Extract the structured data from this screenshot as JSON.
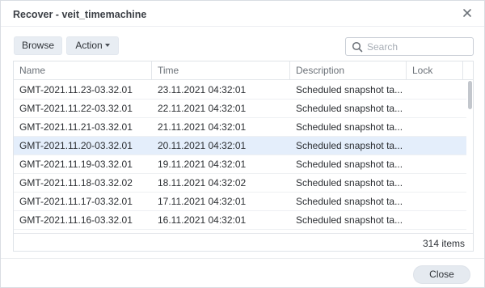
{
  "dialog": {
    "title": "Recover - veit_timemachine"
  },
  "toolbar": {
    "browse_label": "Browse",
    "action_label": "Action"
  },
  "search": {
    "placeholder": "Search",
    "value": ""
  },
  "table": {
    "columns": [
      "Name",
      "Time",
      "Description",
      "Lock"
    ],
    "rows": [
      {
        "name": "GMT-2021.11.23-03.32.01",
        "time": "23.11.2021 04:32:01",
        "description": "Scheduled snapshot ta...",
        "lock": "",
        "selected": false
      },
      {
        "name": "GMT-2021.11.22-03.32.01",
        "time": "22.11.2021 04:32:01",
        "description": "Scheduled snapshot ta...",
        "lock": "",
        "selected": false
      },
      {
        "name": "GMT-2021.11.21-03.32.01",
        "time": "21.11.2021 04:32:01",
        "description": "Scheduled snapshot ta...",
        "lock": "",
        "selected": false
      },
      {
        "name": "GMT-2021.11.20-03.32.01",
        "time": "20.11.2021 04:32:01",
        "description": "Scheduled snapshot ta...",
        "lock": "",
        "selected": true
      },
      {
        "name": "GMT-2021.11.19-03.32.01",
        "time": "19.11.2021 04:32:01",
        "description": "Scheduled snapshot ta...",
        "lock": "",
        "selected": false
      },
      {
        "name": "GMT-2021.11.18-03.32.02",
        "time": "18.11.2021 04:32:02",
        "description": "Scheduled snapshot ta...",
        "lock": "",
        "selected": false
      },
      {
        "name": "GMT-2021.11.17-03.32.01",
        "time": "17.11.2021 04:32:01",
        "description": "Scheduled snapshot ta...",
        "lock": "",
        "selected": false
      },
      {
        "name": "GMT-2021.11.16-03.32.01",
        "time": "16.11.2021 04:32:01",
        "description": "Scheduled snapshot ta...",
        "lock": "",
        "selected": false
      }
    ],
    "item_count": "314 items"
  },
  "footer": {
    "close_label": "Close"
  },
  "icons": {
    "close": "close-icon",
    "search": "search-icon",
    "dropdown": "chevron-down-icon"
  },
  "colors": {
    "selected_row": "#e4eefb",
    "button_bg": "#e8edf3"
  }
}
